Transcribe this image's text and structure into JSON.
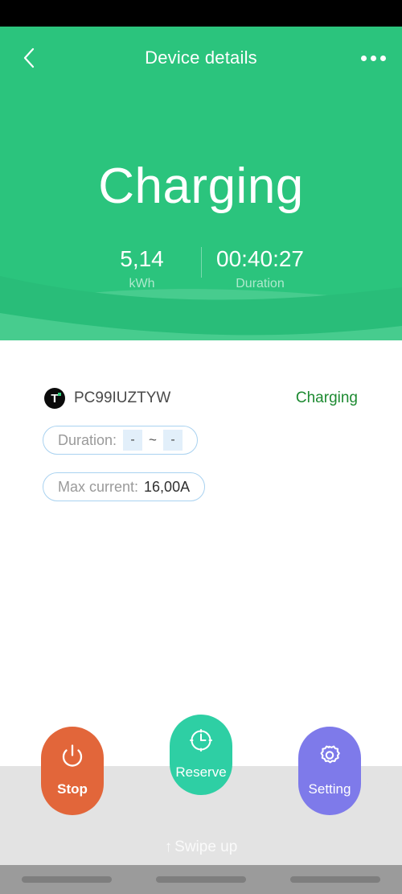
{
  "header": {
    "title": "Device details",
    "back_icon": "chevron-left-icon",
    "more_icon": "more-horizontal-icon"
  },
  "hero": {
    "state_title": "Charging",
    "stats": [
      {
        "value": "5,14",
        "label": "kWh"
      },
      {
        "value": "00:40:27",
        "label": "Duration"
      }
    ],
    "background_color": "#2BC47D"
  },
  "device": {
    "brand_icon": "tuya-logo-icon",
    "brand_letter": "T",
    "id": "PC99IUZTYW",
    "status": "Charging",
    "status_color": "#1D8A31"
  },
  "fields": {
    "duration": {
      "label": "Duration:",
      "start": "-",
      "separator": "~",
      "end": "-"
    },
    "max_current": {
      "label": "Max current:",
      "value": "16,00A"
    }
  },
  "actions": [
    {
      "id": "stop",
      "label": "Stop",
      "icon": "power-icon",
      "color": "#E2663A"
    },
    {
      "id": "reserve",
      "label": "Reserve",
      "icon": "clock-icon",
      "color": "#2ECFA4"
    },
    {
      "id": "setting",
      "label": "Setting",
      "icon": "gear-icon",
      "color": "#7E7AEA"
    }
  ],
  "footer": {
    "swipe_arrow": "↑",
    "swipe_label": "Swipe up"
  }
}
